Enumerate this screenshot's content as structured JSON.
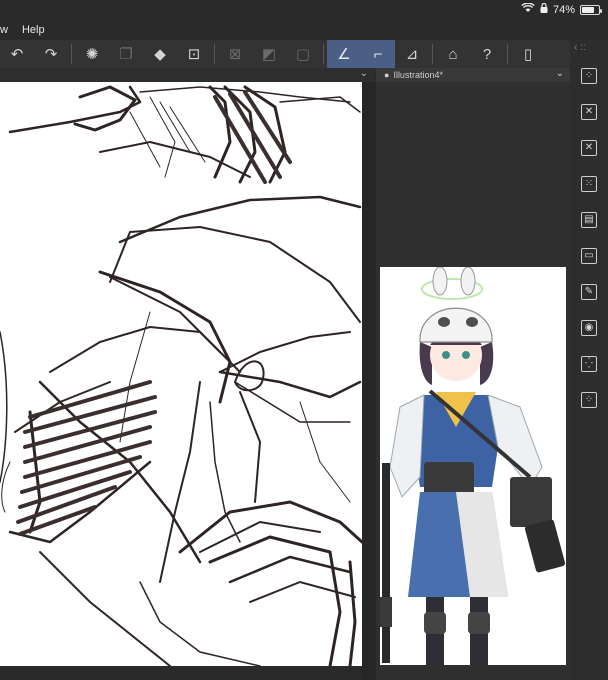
{
  "status": {
    "battery_percent": 74,
    "battery_text": "74%"
  },
  "menu": {
    "items": [
      "w",
      "Help"
    ]
  },
  "canvas": {
    "tab_label": "Illustration4*"
  },
  "icons": {
    "undo": "undo-icon",
    "redo": "redo-icon",
    "transform": "loading-spinner-icon",
    "fill": "fill-bucket-icon",
    "crop": "crop-icon",
    "ruler": "ruler-icon",
    "pen": "pen-icon",
    "brush": "brush-icon",
    "eraser": "eraser-icon",
    "learn": "graduation-cap-icon",
    "help": "help-icon",
    "device": "device-icon"
  },
  "colors": {
    "accent": "#4b5e86",
    "toolbar_bg": "#333333",
    "panel_bg": "#2f2f2f"
  }
}
